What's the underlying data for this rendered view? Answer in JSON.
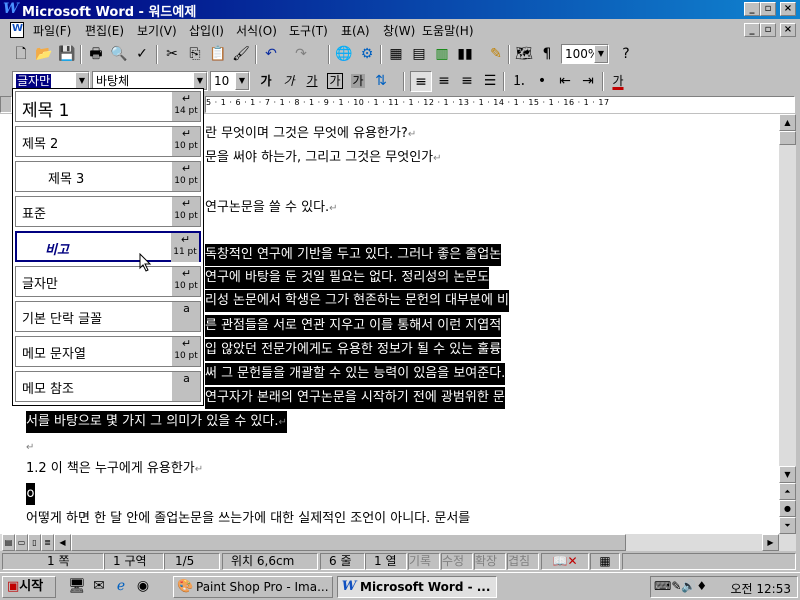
{
  "window": {
    "title": "Microsoft Word - 워드예제",
    "app_icon": "word-w-icon"
  },
  "menu": [
    "파일(F)",
    "편집(E)",
    "보기(V)",
    "삽입(I)",
    "서식(O)",
    "도구(T)",
    "표(A)",
    "창(W)",
    "도움말(H)"
  ],
  "standard_toolbar": {
    "zoom": "100%",
    "icons": [
      "new-icon",
      "open-icon",
      "save-icon",
      "print-icon",
      "print-preview-icon",
      "spelling-icon",
      "cut-icon",
      "copy-icon",
      "paste-icon",
      "format-painter-icon",
      "undo-icon",
      "redo-icon",
      "web-icon",
      "web-toolbar-icon",
      "tables-borders-icon",
      "insert-table-icon",
      "insert-excel-icon",
      "columns-icon",
      "drawing-icon",
      "document-map-icon",
      "show-hide-icon",
      "help-icon"
    ]
  },
  "format_toolbar": {
    "style": "글자만",
    "font": "바탕체",
    "size": "10",
    "bold": "가",
    "italic": "가",
    "underline": "가",
    "char_border": "가",
    "char_shading": "가",
    "font_color": "가"
  },
  "ruler": {
    "marks": "5 · 1 · 6 · 1 · 7 · 1 · 8 · 1 · 9 · 1 · 10 · 1 · 11 · 1 · 12 · 1 · 13 · 1 · 14 · 1 · 15 · 1 · 16 · 1 · 17"
  },
  "style_list": [
    {
      "name": "제목 1",
      "size": "14 pt",
      "mark": "↵"
    },
    {
      "name": "제목 2",
      "size": "10 pt",
      "mark": "↵"
    },
    {
      "name": "제목 3",
      "size": "10 pt",
      "mark": "↵"
    },
    {
      "name": "표준",
      "size": "10 pt",
      "mark": "↵"
    },
    {
      "name": "비고",
      "size": "11 pt",
      "mark": "↵"
    },
    {
      "name": "글자만",
      "size": "10 pt",
      "mark": "↵"
    },
    {
      "name": "기본 단락 글꼴",
      "size": "",
      "mark": "a"
    },
    {
      "name": "메모 문자열",
      "size": "10 pt",
      "mark": "↵"
    },
    {
      "name": "메모 참조",
      "size": "",
      "mark": "a"
    }
  ],
  "document": {
    "lines": [
      {
        "text": "란 무엇이며 그것은 무엇에 유용한가?",
        "pm": "↵",
        "selected": false
      },
      {
        "text": "문을 써야 하는가, 그리고 그것은 무엇인가",
        "pm": "↵",
        "selected": false
      },
      {
        "text": "",
        "pm": "",
        "selected": false
      },
      {
        "text": "연구논문을 쓸 수 있다.",
        "pm": "↵",
        "selected": false
      },
      {
        "text": "",
        "pm": "",
        "selected": false
      },
      {
        "text": "독창적인 연구에 기반을 두고 있다. 그러나 좋은 졸업논",
        "pm": "",
        "selected": true
      },
      {
        "text": " 연구에 바탕을 둔 것일 필요는 없다. 정리성의 논문도",
        "pm": "",
        "selected": true
      },
      {
        "text": "리성 논문에서 학생은 그가 현존하는 문헌의 대부분에 비",
        "pm": "",
        "selected": true
      },
      {
        "text": "른 관점들을 서로 연관 지우고 이를 통해서 이런 지엽적",
        "pm": "",
        "selected": true
      },
      {
        "text": "입 않았던 전문가에게도 유용한 정보가 될 수 있는 훌륭",
        "pm": "",
        "selected": true
      },
      {
        "text": "써 그 문헌들을 개괄할 수 있는 능력이 있음을 보여준다.",
        "pm": "",
        "selected": true
      },
      {
        "text": " 연구자가 본래의 연구논문을 시작하기 전에 광범위한 문",
        "pm": "",
        "selected": true
      },
      {
        "text": "서를 바탕으로 몇 가지 그 의미가 있을 수 있다.",
        "pm": "↵",
        "selected": true
      },
      {
        "text": "",
        "pm": "↵",
        "selected": false
      },
      {
        "text": "1.2 이 책은 누구에게 유용한가",
        "pm": "↵",
        "selected": false
      },
      {
        "text": "o",
        "pm": "",
        "selected": true
      },
      {
        "text": "어떻게 하면 한 달 안에 졸업논문을 쓰는가에 대한 실제적인 조언이 아니다. 문서를",
        "pm": "",
        "selected": false
      }
    ]
  },
  "status": {
    "page": "1 쪽",
    "section": "1 구역",
    "pages": "1/5",
    "position": "위치 6,6cm",
    "line": "6 줄",
    "column": "1 열",
    "rec": "기록",
    "trk": "수정",
    "ext": "확장",
    "ovr": "겹침"
  },
  "taskbar": {
    "start": "시작",
    "tasks": [
      {
        "label": "Paint Shop Pro - Ima...",
        "icon": "paintshop-icon",
        "active": false
      },
      {
        "label": "Microsoft Word - ...",
        "icon": "word-w-icon",
        "active": true
      }
    ],
    "clock": "오전 12:53"
  }
}
